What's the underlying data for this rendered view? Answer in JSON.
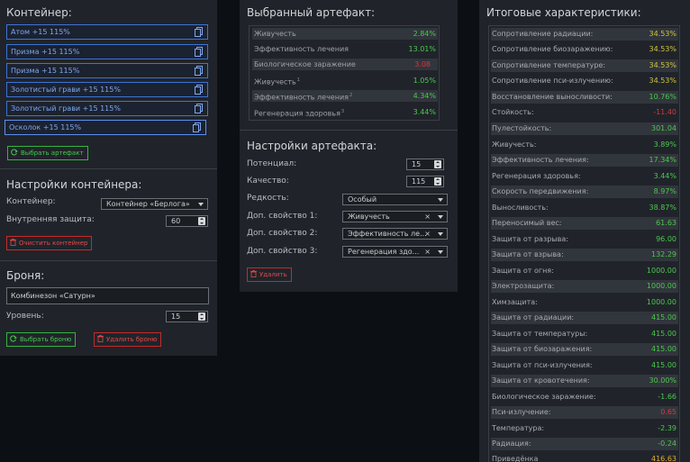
{
  "left": {
    "container_title": "Контейнер:",
    "slots": [
      "Атом +15 115%",
      "Призма +15 115%",
      "Призма +15 115%",
      "Золотистый грави +15 115%",
      "Золотистый грави +15 115%",
      "Осколок +15 115%"
    ],
    "choose_artifact": "Выбрать артефакт",
    "settings_title": "Настройки контейнера:",
    "container_label": "Контейнер:",
    "container_value": "Контейнер «Берлога»",
    "protection_label": "Внутренняя защита:",
    "protection_value": "60",
    "clear_container": "Очистить контейнер",
    "armor_title": "Броня:",
    "armor_value": "Комбинезон «Сатурн»",
    "level_label": "Уровень:",
    "level_value": "15",
    "choose_armor": "Выбрать броню",
    "delete_armor": "Удалить броню"
  },
  "middle": {
    "selected_title": "Выбранный артефакт:",
    "stats": [
      {
        "name": "Живучесть",
        "value": "2.84%",
        "color": "#4cc74f",
        "sup": ""
      },
      {
        "name": "Эффективность лечения",
        "value": "13.01%",
        "color": "#4cc74f",
        "sup": ""
      },
      {
        "name": "Биологическое заражение",
        "value": "3.08",
        "color": "#d8383a",
        "sup": ""
      },
      {
        "name": "Живучесть",
        "value": "1.05%",
        "color": "#4cc74f",
        "sup": "1"
      },
      {
        "name": "Эффективность лечения",
        "value": "4.34%",
        "color": "#4cc74f",
        "sup": "2"
      },
      {
        "name": "Регенерация здоровья",
        "value": "3.44%",
        "color": "#4cc74f",
        "sup": "3"
      }
    ],
    "settings_title": "Настройки артефакта:",
    "potential_label": "Потенциал:",
    "potential_value": "15",
    "quality_label": "Качество:",
    "quality_value": "115",
    "rarity_label": "Редкость:",
    "rarity_value": "Особый",
    "prop1_label": "Доп. свойство 1:",
    "prop1_value": "Живучесть",
    "prop2_label": "Доп. свойство 2:",
    "prop2_value": "Эффективность ле...",
    "prop3_label": "Доп. свойство 3:",
    "prop3_value": "Регенерация здо...",
    "delete": "Удалить"
  },
  "right": {
    "title": "Итоговые характеристики:",
    "stats": [
      {
        "name": "Сопротивление радиации:",
        "value": "34.53%",
        "color": "#cfc53a"
      },
      {
        "name": "Сопротивление биозаражению:",
        "value": "34.53%",
        "color": "#cfc53a"
      },
      {
        "name": "Сопротивление температуре:",
        "value": "34.53%",
        "color": "#cfc53a"
      },
      {
        "name": "Сопротивление пси-излучению:",
        "value": "34.53%",
        "color": "#cfc53a"
      },
      {
        "name": "Восстановление выносливости:",
        "value": "10.76%",
        "color": "#4cc74f"
      },
      {
        "name": "Стойкость:",
        "value": "-11.40",
        "color": "#d8383a"
      },
      {
        "name": "Пулестойкость:",
        "value": "301.04",
        "color": "#4cc74f"
      },
      {
        "name": "Живучесть:",
        "value": "3.89%",
        "color": "#4cc74f"
      },
      {
        "name": "Эффективность лечения:",
        "value": "17.34%",
        "color": "#4cc74f"
      },
      {
        "name": "Регенерация здоровья:",
        "value": "3.44%",
        "color": "#4cc74f"
      },
      {
        "name": "Скорость передвижения:",
        "value": "8.97%",
        "color": "#4cc74f"
      },
      {
        "name": "Выносливость:",
        "value": "38.87%",
        "color": "#4cc74f"
      },
      {
        "name": "Переносимый вес:",
        "value": "61.63",
        "color": "#4cc74f"
      },
      {
        "name": "Защита от разрыва:",
        "value": "96.00",
        "color": "#4cc74f"
      },
      {
        "name": "Защита от взрыва:",
        "value": "132.29",
        "color": "#4cc74f"
      },
      {
        "name": "Защита от огня:",
        "value": "1000.00",
        "color": "#4cc74f"
      },
      {
        "name": "Электрозащита:",
        "value": "1000.00",
        "color": "#4cc74f"
      },
      {
        "name": "Химзащита:",
        "value": "1000.00",
        "color": "#4cc74f"
      },
      {
        "name": "Защита от радиации:",
        "value": "415.00",
        "color": "#4cc74f"
      },
      {
        "name": "Защита от температуры:",
        "value": "415.00",
        "color": "#4cc74f"
      },
      {
        "name": "Защита от биозаражения:",
        "value": "415.00",
        "color": "#4cc74f"
      },
      {
        "name": "Защита от пси-излучения:",
        "value": "415.00",
        "color": "#4cc74f"
      },
      {
        "name": "Защита от кровотечения:",
        "value": "30.00%",
        "color": "#4cc74f"
      },
      {
        "name": "Биологическое заражение:",
        "value": "-1.66",
        "color": "#4cc74f"
      },
      {
        "name": "Пси-излучение:",
        "value": "0.65",
        "color": "#d8383a"
      },
      {
        "name": "Температура:",
        "value": "-2.39",
        "color": "#4cc74f"
      },
      {
        "name": "Радиация:",
        "value": "-0.24",
        "color": "#4cc74f"
      },
      {
        "name": "Приведёнка",
        "value": "416.63",
        "color": "#e0b032"
      }
    ]
  }
}
